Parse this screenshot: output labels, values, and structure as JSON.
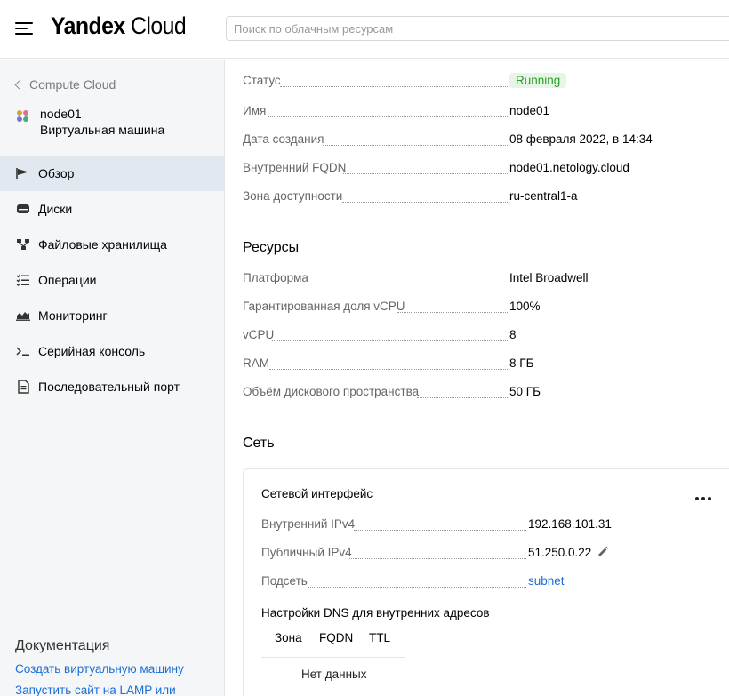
{
  "header": {
    "logo_bold": "Yandex",
    "logo_light": "Cloud",
    "search_placeholder": "Поиск по облачным ресурсам"
  },
  "sidebar": {
    "back_label": "Compute Cloud",
    "vm_name": "node01",
    "vm_type": "Виртуальная машина",
    "items": [
      {
        "label": "Обзор",
        "icon": "flag-icon",
        "active": true
      },
      {
        "label": "Диски",
        "icon": "disk-icon"
      },
      {
        "label": "Файловые хранилища",
        "icon": "file-storage-icon"
      },
      {
        "label": "Операции",
        "icon": "operations-list-icon"
      },
      {
        "label": "Мониторинг",
        "icon": "monitoring-chart-icon"
      },
      {
        "label": "Серийная консоль",
        "icon": "terminal-icon"
      },
      {
        "label": "Последовательный порт",
        "icon": "document-icon"
      }
    ],
    "docs_title": "Документация",
    "docs_links": [
      "Создать виртуальную машину",
      "Запустить сайт на LAMP или"
    ]
  },
  "overview": {
    "status_label": "Статус",
    "status_value": "Running",
    "status_color": "#2b9f2b",
    "name_label": "Имя",
    "name_value": "node01",
    "created_label": "Дата создания",
    "created_value": "08 февраля 2022, в 14:34",
    "fqdn_label": "Внутренний FQDN",
    "fqdn_value": "node01.netology.cloud",
    "zone_label": "Зона доступности",
    "zone_value": "ru-central1-a"
  },
  "resources": {
    "title": "Ресурсы",
    "rows": [
      {
        "label": "Платформа",
        "value": "Intel Broadwell"
      },
      {
        "label": "Гарантированная доля vCPU",
        "value": "100%"
      },
      {
        "label": "vCPU",
        "value": "8"
      },
      {
        "label": "RAM",
        "value": "8 ГБ"
      },
      {
        "label": "Объём дискового пространства",
        "value": "50 ГБ"
      }
    ]
  },
  "network": {
    "title": "Сеть",
    "card_title": "Сетевой интерфейс",
    "ipv4_internal_label": "Внутренний IPv4",
    "ipv4_internal_value": "192.168.101.31",
    "ipv4_public_label": "Публичный IPv4",
    "ipv4_public_value": "51.250.0.22",
    "subnet_label": "Подсеть",
    "subnet_value": "subnet",
    "dns_title": "Настройки DNS для внутренних адресов",
    "dns_columns": [
      "Зона",
      "FQDN",
      "TTL"
    ],
    "dns_empty": "Нет данных"
  },
  "colors": {
    "accent_link": "#1a6edb",
    "active_nav_bg": "#e1e8f0",
    "sidebar_bg": "#f5f6f7"
  }
}
